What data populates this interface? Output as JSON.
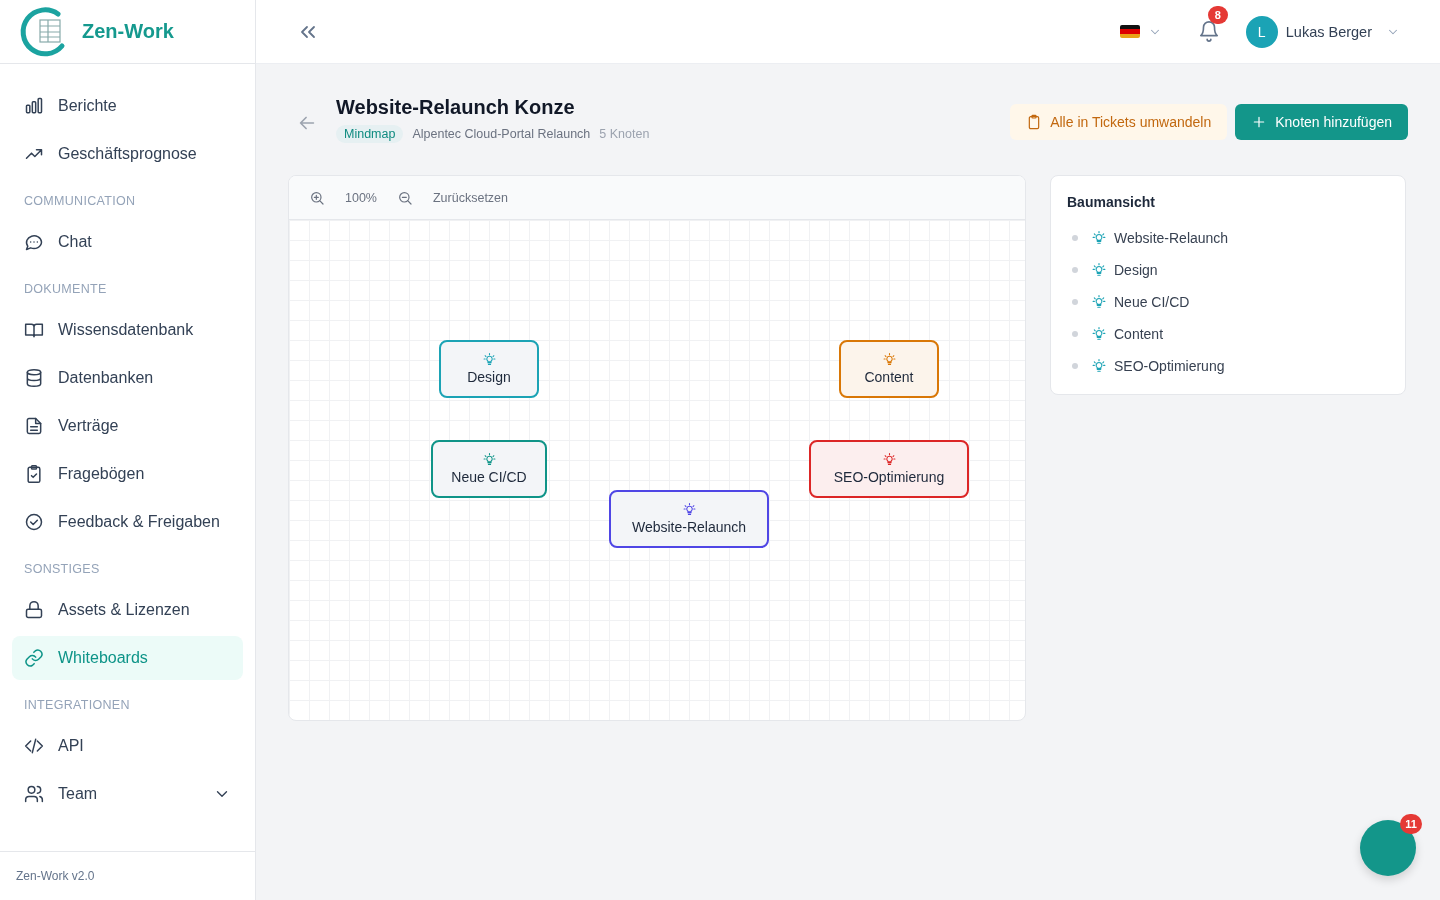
{
  "brand": {
    "name": "Zen-Work"
  },
  "sidebar": {
    "sections": [
      {
        "items": [
          {
            "label": "Berichte",
            "selected": false
          },
          {
            "label": "Geschäftsprognose",
            "selected": false
          }
        ]
      },
      {
        "title": "COMMUNICATION",
        "items": [
          {
            "label": "Chat",
            "selected": false
          }
        ]
      },
      {
        "title": "DOKUMENTE",
        "items": [
          {
            "label": "Wissensdatenbank",
            "selected": false
          },
          {
            "label": "Datenbanken",
            "selected": false
          },
          {
            "label": "Verträge",
            "selected": false
          },
          {
            "label": "Fragebögen",
            "selected": false
          },
          {
            "label": "Feedback & Freigaben",
            "selected": false
          }
        ]
      },
      {
        "title": "SONSTIGES",
        "items": [
          {
            "label": "Assets & Lizenzen",
            "selected": false
          },
          {
            "label": "Whiteboards",
            "selected": true
          }
        ]
      },
      {
        "title": "INTEGRATIONEN",
        "items": [
          {
            "label": "API",
            "selected": false
          },
          {
            "label": "Team",
            "selected": false,
            "expanded": false
          }
        ]
      }
    ],
    "footer": "Zen-Work v2.0"
  },
  "header": {
    "notifications": "8",
    "user": {
      "initial": "L",
      "name": "Lukas Berger"
    }
  },
  "page": {
    "title": "Website-Relaunch Konze",
    "tag": "Mindmap",
    "project": "Alpentec Cloud-Portal Relaunch",
    "count": "5 Knoten",
    "actions": [
      {
        "label": "Alle in Tickets umwandeln",
        "kind": "soft"
      },
      {
        "label": "Knoten hinzufügen",
        "kind": "primary"
      }
    ]
  },
  "canvas": {
    "zoom": "100%",
    "reset": "Zurücksetzen",
    "nodes": [
      {
        "label": "Design",
        "color": "#1ba3b5"
      },
      {
        "label": "Content",
        "color": "#d97706"
      },
      {
        "label": "Neue CI/CD",
        "color": "#0f9488"
      },
      {
        "label": "SEO-Optimierung",
        "color": "#dc2626"
      },
      {
        "label": "Website-Relaunch",
        "color": "#4f46e5"
      }
    ]
  },
  "tree": {
    "title": "Baumansicht",
    "items": [
      {
        "label": "Website-Relaunch"
      },
      {
        "label": "Design"
      },
      {
        "label": "Neue CI/CD"
      },
      {
        "label": "Content"
      },
      {
        "label": "SEO-Optimierung"
      }
    ]
  },
  "fab": {
    "badge": "11"
  }
}
